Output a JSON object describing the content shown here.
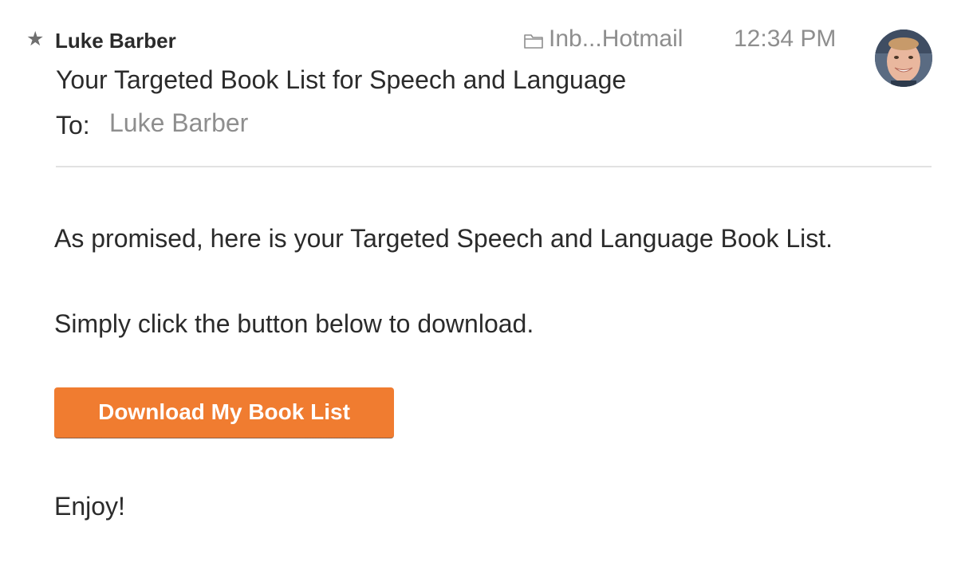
{
  "header": {
    "star_icon": "star-icon",
    "sender": "Luke Barber",
    "mailbox_icon": "folder-icon",
    "mailbox": "Inb...Hotmail",
    "time": "12:34 PM",
    "subject": "Your Targeted Book List for Speech and Language",
    "to_label": "To:",
    "to_value": "Luke Barber"
  },
  "body": {
    "paragraph_1": "As promised, here is your Targeted Speech and Language Book List.",
    "paragraph_2": "Simply click the button below to download.",
    "button_label": "Download My Book List",
    "paragraph_3": "Enjoy!"
  },
  "colors": {
    "button_bg": "#f07c30",
    "muted_text": "#8e8e8e",
    "text": "#2b2b2b"
  }
}
